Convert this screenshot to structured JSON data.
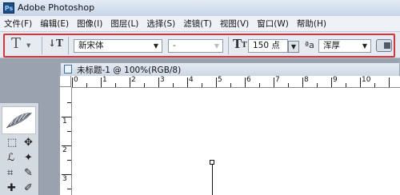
{
  "window": {
    "title": "Adobe Photoshop",
    "app_icon_label": "Ps"
  },
  "menu": [
    "文件(F)",
    "编辑(E)",
    "图像(I)",
    "图层(L)",
    "选择(S)",
    "滤镜(T)",
    "视图(V)",
    "窗口(W)",
    "帮助(H)"
  ],
  "options_bar": {
    "tool_preset_icon": "type-tool-icon",
    "orientation_icon": "toggle-text-orientation-icon",
    "font_family": "新宋体",
    "font_style": "-",
    "font_size": "150 点",
    "antialias": "浑厚",
    "panel_toggle_icon": "character-panel-icon",
    "highlight_color": "#d8343a"
  },
  "document": {
    "tab_title": "未标题-1 @ 100%(RGB/8)",
    "ruler_top": [
      "0",
      "1",
      "2",
      "3",
      "4",
      "5",
      "6",
      "7",
      "8",
      "9",
      "10"
    ],
    "ruler_left": [
      "1",
      "2",
      "3"
    ]
  }
}
